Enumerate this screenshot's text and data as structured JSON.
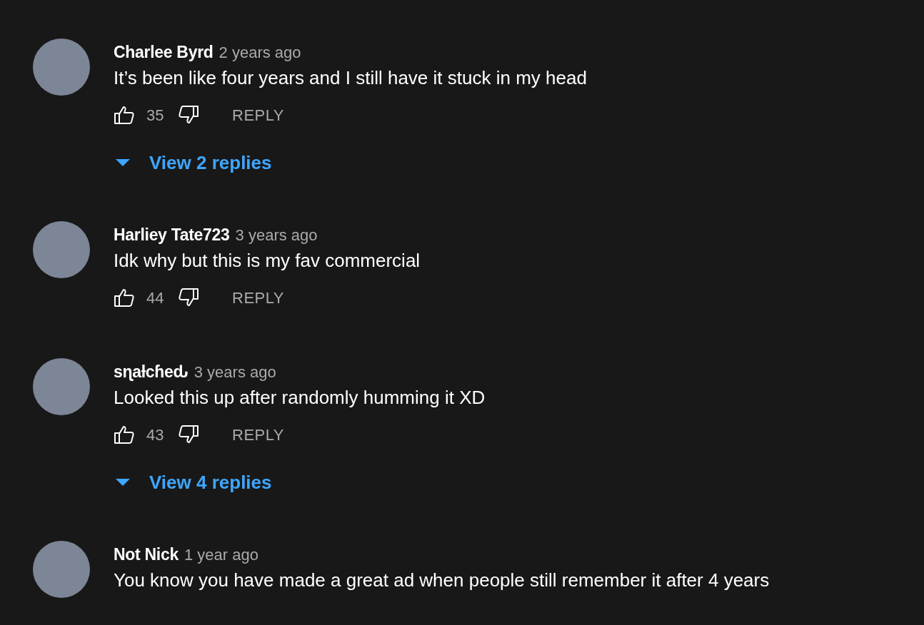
{
  "comments": [
    {
      "author": "Charlee Byrd",
      "time": "2 years ago",
      "text": "It’s been like four years and I still have it stuck in my head",
      "likes": "35",
      "reply_label": "REPLY",
      "replies": {
        "label": "View 2 replies",
        "expanded": false
      }
    },
    {
      "author": "Harliey Tate723",
      "time": "3 years ago",
      "text": "Idk why but this is my fav commercial",
      "likes": "44",
      "reply_label": "REPLY"
    },
    {
      "author": "sɳaƚcɦeԃ",
      "time": "3 years ago",
      "text": "Looked this up after randomly humming it XD",
      "likes": "43",
      "reply_label": "REPLY",
      "replies": {
        "label": "View 4 replies",
        "expanded": false
      }
    },
    {
      "author": "Not Nick",
      "time": "1 year ago",
      "text": "You know you have made a great ad when people still remember it after 4 years"
    }
  ]
}
